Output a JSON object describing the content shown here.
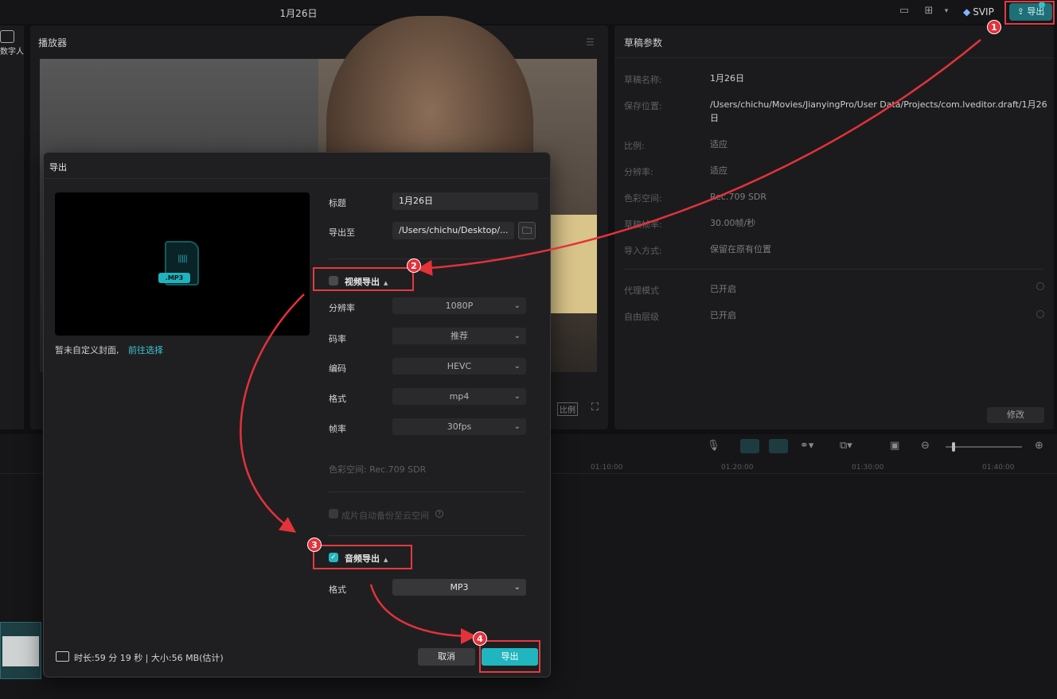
{
  "topbar": {
    "title": "1月26日",
    "svip_label": "SVIP",
    "export_label": "导出"
  },
  "left_strip": {
    "label": "数字人"
  },
  "player": {
    "title": "播放器",
    "ratio_label": "比例"
  },
  "props": {
    "title": "草稿参数",
    "rows": [
      {
        "key": "草稿名称:",
        "value": "1月26日"
      },
      {
        "key": "保存位置:",
        "value": "/Users/chichu/Movies/JianyingPro/User Data/Projects/com.lveditor.draft/1月26日"
      },
      {
        "key": "比例:",
        "value": "适应"
      },
      {
        "key": "分辨率:",
        "value": "适应"
      },
      {
        "key": "色彩空间:",
        "value": "Rec.709 SDR"
      },
      {
        "key": "草稿帧率:",
        "value": "30.00帧/秒"
      },
      {
        "key": "导入方式:",
        "value": "保留在原有位置"
      },
      {
        "key": "代理模式",
        "value": "已开启"
      },
      {
        "key": "自由层级",
        "value": "已开启"
      }
    ],
    "modify_label": "修改"
  },
  "timeline": {
    "ticks": [
      "01:10:00",
      "01:20:00",
      "01:30:00",
      "01:40:00"
    ]
  },
  "export_dialog": {
    "title": "导出",
    "cover_note": "暂未自定义封面,",
    "cover_link": "前往选择",
    "file_tag": ".MP3",
    "title_label": "标题",
    "title_value": "1月26日",
    "export_to_label": "导出至",
    "export_to_value": "/Users/chichu/Desktop/...",
    "video_section": {
      "label": "视频导出",
      "checked": false,
      "fields": [
        {
          "label": "分辨率",
          "value": "1080P"
        },
        {
          "label": "码率",
          "value": "推荐"
        },
        {
          "label": "编码",
          "value": "HEVC"
        },
        {
          "label": "格式",
          "value": "mp4"
        },
        {
          "label": "帧率",
          "value": "30fps"
        }
      ],
      "color_space": "色彩空间:   Rec.709 SDR",
      "backup_label": "成片自动备份至云空间"
    },
    "audio_section": {
      "label": "音频导出",
      "checked": true,
      "format_label": "格式",
      "format_value": "MP3"
    },
    "footer_info": "时长:59 分 19 秒 | 大小:56 MB(估计)",
    "cancel_label": "取消",
    "export_label": "导出"
  },
  "annotations": {
    "color": "#e3323a",
    "badges": [
      "1",
      "2",
      "3",
      "4"
    ]
  }
}
